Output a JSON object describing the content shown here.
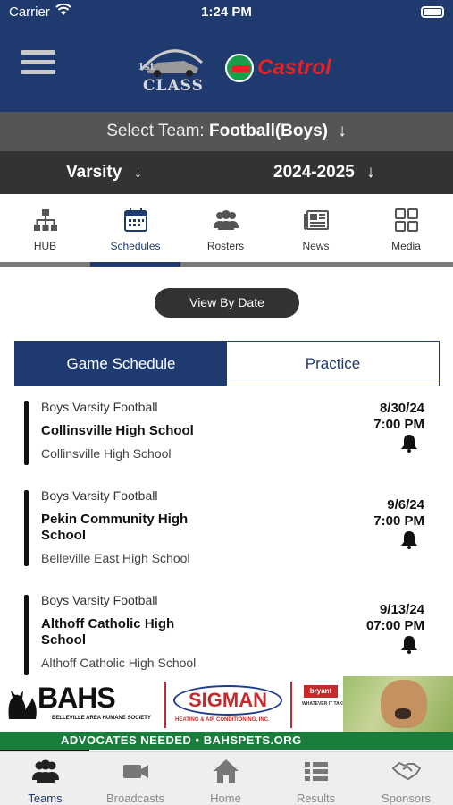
{
  "status_bar": {
    "carrier": "Carrier",
    "time": "1:24 PM"
  },
  "header": {
    "logo_text": "CLASS",
    "logo_superscript": "1st",
    "sponsor": "Castrol"
  },
  "team_selector": {
    "label": "Select Team:",
    "value": "Football(Boys)",
    "arrow": "↓"
  },
  "level_selector": {
    "level": "Varsity",
    "season": "2024-2025",
    "arrow": "↓"
  },
  "nav_tabs": [
    {
      "label": "HUB",
      "icon": "hub-icon"
    },
    {
      "label": "Schedules",
      "icon": "calendar-icon",
      "active": true
    },
    {
      "label": "Rosters",
      "icon": "roster-icon"
    },
    {
      "label": "News",
      "icon": "news-icon"
    },
    {
      "label": "Media",
      "icon": "media-grid-icon"
    }
  ],
  "view_by_date": "View By Date",
  "segments": {
    "game_schedule": "Game Schedule",
    "practice": "Practice",
    "selected": "Game Schedule"
  },
  "games": [
    {
      "category": "Boys Varsity Football",
      "opponent": "Collinsville High School",
      "location": "Collinsville High School",
      "date": "8/30/24",
      "time": "7:00 PM"
    },
    {
      "category": "Boys Varsity Football",
      "opponent": "Pekin Community High School",
      "location": "Belleville East High School",
      "date": "9/6/24",
      "time": "7:00 PM"
    },
    {
      "category": "Boys Varsity Football",
      "opponent": "Althoff Catholic High School",
      "location": "Althoff Catholic High School",
      "date": "9/13/24",
      "time": "07:00 PM"
    }
  ],
  "ad": {
    "bahs": "BAHS",
    "bahs_sub": "BELLEVILLE AREA HUMANE SOCIETY",
    "sigman": "SIGMAN",
    "sigman_sub": "HEATING & AIR CONDITIONING, INC.",
    "bryant": "bryant",
    "bryant_sub": "WHATEVER IT TAKES.",
    "strip": "ADVOCATES NEEDED • BAHSPETS.ORG"
  },
  "bottom_tabs": [
    {
      "label": "Teams",
      "icon": "teams-icon",
      "active": true
    },
    {
      "label": "Broadcasts",
      "icon": "video-camera-icon"
    },
    {
      "label": "Home",
      "icon": "home-icon"
    },
    {
      "label": "Results",
      "icon": "results-list-icon"
    },
    {
      "label": "Sponsors",
      "icon": "handshake-icon"
    }
  ],
  "colors": {
    "navy": "#1e3a6e",
    "dark_gray": "#333333",
    "mid_gray": "#555555",
    "castrol_red": "#e42229",
    "castrol_green": "#1a9d48"
  }
}
